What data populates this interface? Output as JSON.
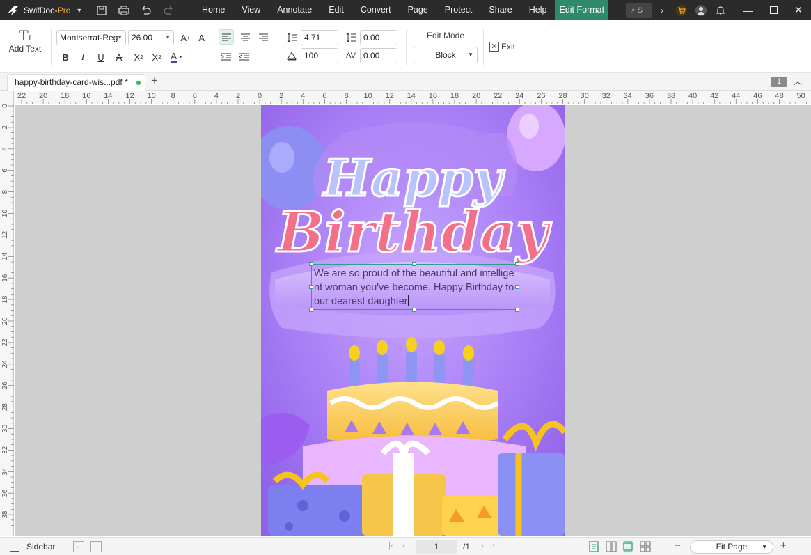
{
  "app": {
    "name_main": "SwifDoo-",
    "name_suffix": "Pro",
    "search_placeholder": "S"
  },
  "menu": [
    "Home",
    "View",
    "Annotate",
    "Edit",
    "Convert",
    "Page",
    "Protect",
    "Share",
    "Help",
    "Edit Format"
  ],
  "toolbar": {
    "add_text_label": "Add Text",
    "font_family": "Montserrat-Reg",
    "font_size": "26.00",
    "line_spacing": "4.71",
    "paragraph_spacing": "0.00",
    "scale": "100",
    "char_spacing": "0.00",
    "edit_mode_label": "Edit Mode",
    "edit_mode_value": "Block",
    "exit_label": "Exit",
    "font_color": "#5a3e9e"
  },
  "tab": {
    "title": "happy-birthday-card-wis...pdf *",
    "page_badge": "1"
  },
  "ruler": {
    "h_ticks": [
      "22",
      "20",
      "18",
      "16",
      "14",
      "12",
      "10",
      "8",
      "6",
      "4",
      "2",
      "0",
      "2",
      "4",
      "6",
      "8",
      "10",
      "12",
      "14",
      "16",
      "18",
      "20",
      "22",
      "24",
      "26",
      "28",
      "30",
      "32",
      "34",
      "36",
      "38",
      "40",
      "42",
      "44",
      "46",
      "48",
      "50"
    ],
    "v_ticks": [
      "0",
      "2",
      "4",
      "6",
      "8",
      "10",
      "12",
      "14",
      "16",
      "18",
      "20",
      "22",
      "24",
      "26",
      "28",
      "30",
      "32",
      "34",
      "36",
      "38"
    ]
  },
  "document": {
    "card_line1": "Happy",
    "card_line2": "Birthday",
    "text_box": "We are so proud of the beautiful and intelligent woman you've become. Happy Birthday to our dearest daughter"
  },
  "status": {
    "sidebar_label": "Sidebar",
    "current_page": "1",
    "total_pages": "/1",
    "zoom": "Fit Page"
  },
  "colors": {
    "accent": "#2f8a6a",
    "titlebar": "#2b2b2b",
    "selection": "#2f9f8a"
  }
}
